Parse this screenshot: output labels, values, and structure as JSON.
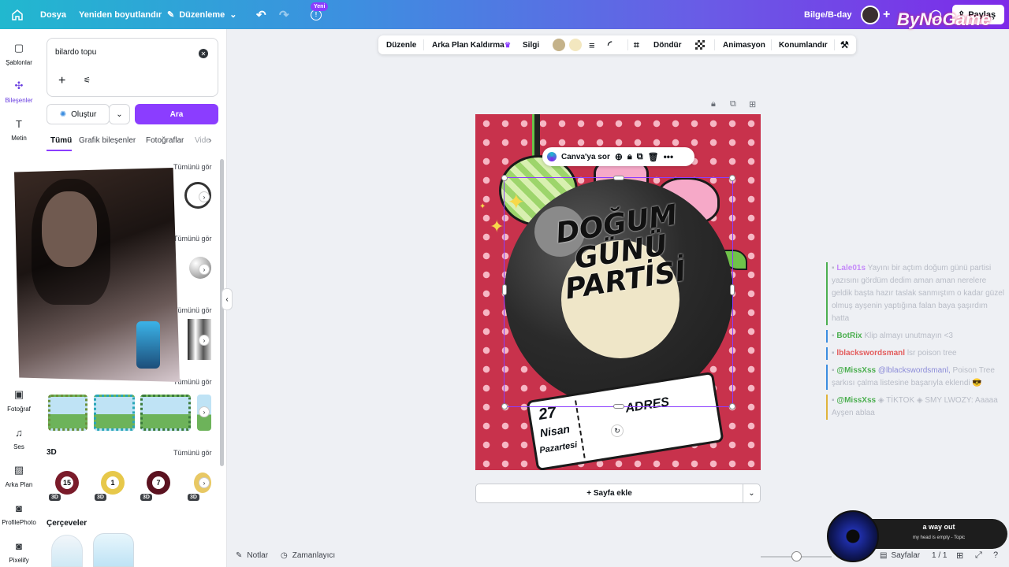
{
  "topbar": {
    "file": "Dosya",
    "resize": "Yeniden boyutlandır",
    "edit": "Düzenleme",
    "new_badge": "Yeni",
    "project_name": "Bilge/B-day",
    "share": "Paylaş",
    "watermark": "ByNoGame"
  },
  "rail": {
    "items": [
      {
        "label": "Şablonlar",
        "icon": "template-icon"
      },
      {
        "label": "Bileşenler",
        "icon": "elements-icon"
      },
      {
        "label": "Metin",
        "icon": "text-icon"
      },
      {
        "label": "Fotoğraf",
        "icon": "photo-icon"
      },
      {
        "label": "Ses",
        "icon": "audio-icon"
      },
      {
        "label": "Arka Plan",
        "icon": "background-icon"
      },
      {
        "label": "ProfilePhoto",
        "icon": "profilephoto-icon"
      },
      {
        "label": "Pixelify",
        "icon": "pixelify-icon"
      }
    ]
  },
  "panel": {
    "search_value": "bilardo topu",
    "create_label": "Oluştur",
    "search_button": "Ara",
    "tabs": [
      "Tümü",
      "Grafik bileşenler",
      "Fotoğraflar",
      "Video"
    ],
    "see_all": "Tümünü gör",
    "section_3d": "3D",
    "section_frames": "Çerçeveler",
    "balls": [
      {
        "number": "15",
        "color": "#7a1b2a"
      },
      {
        "number": "1",
        "color": "#e7c84a"
      },
      {
        "number": "7",
        "color": "#5b1220"
      }
    ],
    "badge_3d": "3D"
  },
  "context_toolbar": {
    "edit": "Düzenle",
    "bg_remove": "Arka Plan Kaldırma",
    "erase": "Silgi",
    "color1": "#c4b28a",
    "color2": "#f3e7bf",
    "rotate": "Döndür",
    "animate": "Animasyon",
    "position": "Konumlandır"
  },
  "selection_toolbar": {
    "ask": "Canva'ya sor"
  },
  "canvas": {
    "title_line1": "DOĞUM",
    "title_line2": "GÜNÜ",
    "title_line3": "PARTİSİ",
    "date_day": "27",
    "date_month": "Nisan",
    "date_weekday": "Pazartesi",
    "address": "ADRES",
    "bg_color": "#c8324c"
  },
  "add_page": "+ Sayfa ekle",
  "bottom": {
    "notes": "Notlar",
    "timer": "Zamanlayıcı",
    "pages": "Sayfalar",
    "page_count": "1 / 1"
  },
  "chat": [
    {
      "user": "Lale01s",
      "text": "Yayını bir açtım doğum günü partisi yazısını gördüm dedim aman aman nerelere geldik başta hazır taslak sanmıştım o kadar güzel olmuş ayşenin yaptığına falan baya şaşırdım hatta",
      "color": "#c58af9"
    },
    {
      "user": "BotRix",
      "text": "Klip almayı unutmayın <3",
      "color": "#4caf50"
    },
    {
      "user": "lblackswordsmanl",
      "text": "lsr poison tree",
      "color": "#e35d5d"
    },
    {
      "user": "@MissXss",
      "mention": "@lblackswordsmanl,",
      "text": "Poison Tree şarkısı çalma listesine başarıyla eklendi 😎",
      "color": "#4caf50"
    },
    {
      "user": "@MissXss",
      "text": "◈ TİKTOK ◈ SMY LWOZY: Aaaaa Ayşen ablaa",
      "color": "#4caf50"
    }
  ],
  "music": {
    "title": "a way out",
    "subtitle": "my head is empty - Topic"
  }
}
